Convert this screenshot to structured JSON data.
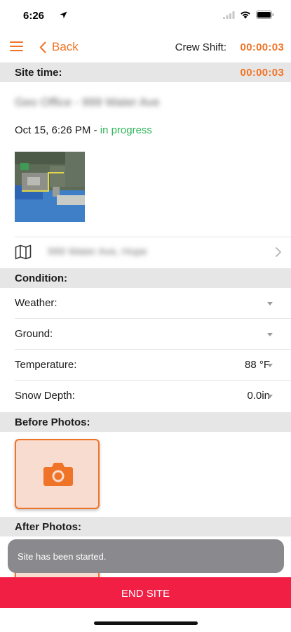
{
  "status_bar": {
    "time": "6:26"
  },
  "nav": {
    "back_label": "Back",
    "crew_shift_label": "Crew Shift:",
    "crew_shift_time": "00:00:03"
  },
  "site_time": {
    "label": "Site time:",
    "value": "00:00:03"
  },
  "site": {
    "name": "Geo Office - 999 Water Ave",
    "date": "Oct 15, 6:26 PM",
    "separator": " - ",
    "status": "in progress",
    "address": "999 Water Ave, Hope"
  },
  "condition": {
    "header": "Condition:",
    "fields": [
      {
        "label": "Weather:",
        "value": ""
      },
      {
        "label": "Ground:",
        "value": ""
      },
      {
        "label": "Temperature:",
        "value": "88 °F"
      },
      {
        "label": "Snow Depth:",
        "value": "0.0in"
      }
    ]
  },
  "before_photos": {
    "header": "Before Photos:"
  },
  "after_photos": {
    "header": "After Photos:"
  },
  "toast": {
    "message": "Site has been started."
  },
  "end_site": {
    "label": "END SITE"
  },
  "colors": {
    "accent": "#f07427",
    "status_green": "#2fb45a",
    "end_button": "#f21f45"
  },
  "icons": [
    "menu-icon",
    "back-chevron-icon",
    "map-icon",
    "chevron-right-icon",
    "camera-icon",
    "wifi-icon",
    "battery-icon",
    "location-arrow-icon"
  ]
}
